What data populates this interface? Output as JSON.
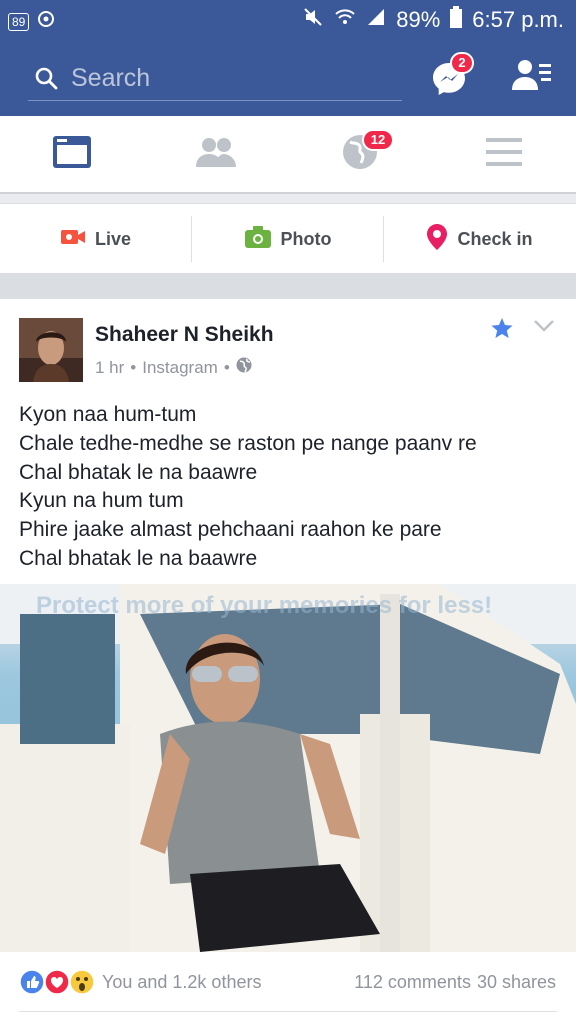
{
  "status_bar": {
    "notif_badge": "89",
    "battery": "89%",
    "time": "6:57 p.m."
  },
  "header": {
    "search_placeholder": "Search",
    "messenger_count": "2"
  },
  "nav": {
    "notifications_count": "12"
  },
  "composer": {
    "live_label": "Live",
    "photo_label": "Photo",
    "checkin_label": "Check in"
  },
  "post": {
    "author": "Shaheer N Sheikh",
    "time": "1 hr",
    "source": "Instagram",
    "lines": [
      "Kyon naa hum-tum",
      "Chale tedhe-medhe se raston pe nange paanv re",
      "Chal bhatak le na baawre",
      "Kyun na hum tum",
      "Phire jaake almast pehchaani raahon ke pare",
      "Chal bhatak le na baawre"
    ],
    "photo_banner": "Protect more of your memories for less!",
    "reactions_text": "You and 1.2k others",
    "comments": "112 comments",
    "shares": "30 shares"
  },
  "colors": {
    "brand": "#3b5998",
    "badge": "#f02849",
    "live": "#f5533d",
    "photo": "#6bb241",
    "checkin": "#e91e63",
    "star": "#4b83ed"
  }
}
